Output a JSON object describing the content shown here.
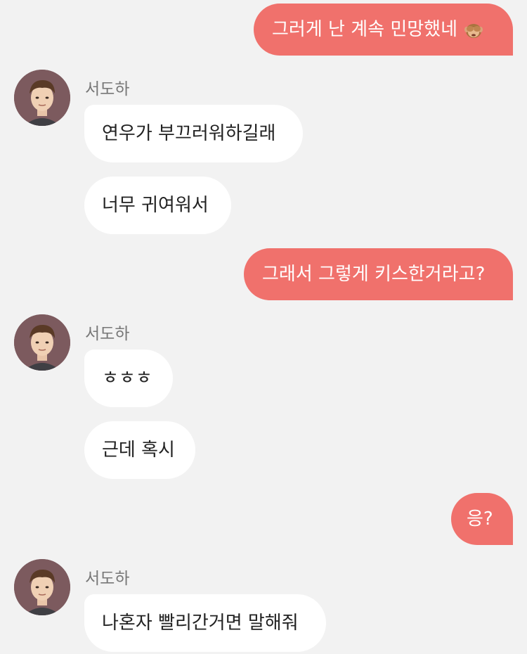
{
  "conversation": {
    "contact_name": "서도하",
    "messages": [
      {
        "side": "out",
        "text": "그러게 난 계속 민망했네",
        "emoji": "see-no-evil-monkey"
      },
      {
        "side": "in",
        "text": "연우가 부끄러워하길래"
      },
      {
        "side": "in",
        "text": "너무 귀여워서"
      },
      {
        "side": "out",
        "text": "그래서 그렇게 키스한거라고?"
      },
      {
        "side": "in",
        "text": "ㅎㅎㅎ"
      },
      {
        "side": "in",
        "text": "근데 혹시"
      },
      {
        "side": "out",
        "text": "응?"
      },
      {
        "side": "in",
        "text": "나혼자 빨리간거면 말해줘"
      }
    ]
  },
  "colors": {
    "background": "#f2f2f2",
    "outgoing_bubble": "#f0716c",
    "incoming_bubble": "#ffffff",
    "sender_name": "#777777"
  }
}
